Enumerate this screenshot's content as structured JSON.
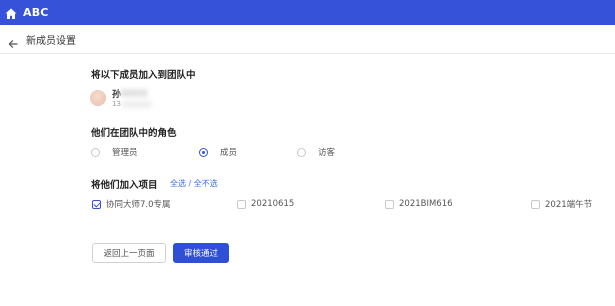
{
  "app": {
    "title": "ABC",
    "icon": "home-icon"
  },
  "header": {
    "title": "新成员设置",
    "back_icon": "arrow-left-icon"
  },
  "members_section": {
    "title": "将以下成员加入到团队中",
    "members": [
      {
        "name": "孙",
        "phone": "13"
      }
    ]
  },
  "role_section": {
    "title": "他们在团队中的角色",
    "options": [
      {
        "label": "管理员",
        "selected": false
      },
      {
        "label": "成员",
        "selected": true
      },
      {
        "label": "访客",
        "selected": false
      }
    ]
  },
  "projects_section": {
    "title": "将他们加入项目",
    "select_all": "全选",
    "separator": " / ",
    "deselect_all": "全不选",
    "projects": [
      {
        "label": "协同大师7.0专属",
        "checked": true
      },
      {
        "label": "20210615",
        "checked": false
      },
      {
        "label": "2021BIM616",
        "checked": false
      },
      {
        "label": "2021端午节",
        "checked": false
      }
    ]
  },
  "buttons": {
    "back": "返回上一页面",
    "approve": "审核通过"
  },
  "colors": {
    "primary": "#3652d9",
    "link": "#3a6fe0"
  }
}
